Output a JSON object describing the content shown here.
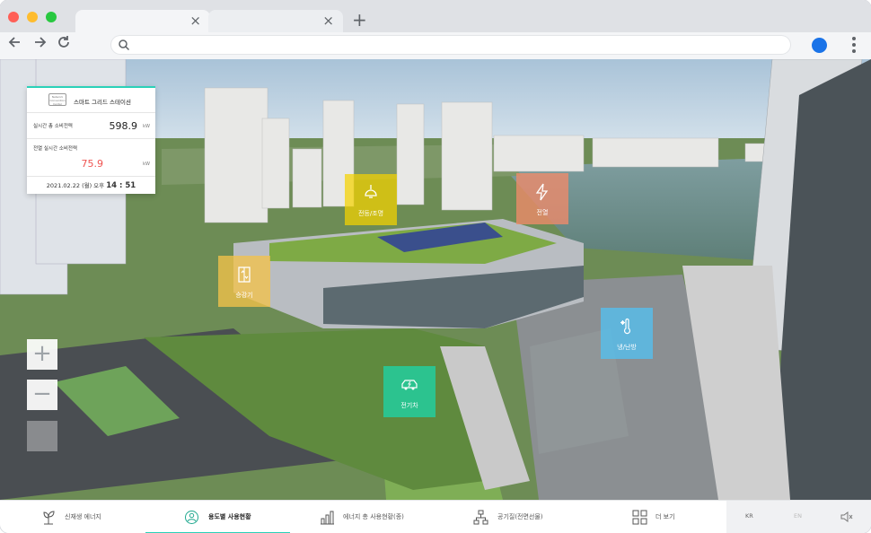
{
  "browser": {
    "tabs": [
      {
        "title": "",
        "close": "×"
      },
      {
        "title": "",
        "close": "×"
      }
    ],
    "new_tab": "+",
    "address": "",
    "address_placeholder": ""
  },
  "info_card": {
    "brand_lines": [
      "Network",
      "Convention",
      "Center"
    ],
    "station_name": "스마트 그리드 스테이션",
    "realtime_total_label": "실시간 총 소비전력",
    "realtime_total_value": "598.9",
    "realtime_total_unit": "kW",
    "lighting_label": "전열 실시간 소비전력",
    "lighting_value": "75.9",
    "lighting_unit": "kW",
    "timestamp_prefix": "2021.02.22 (월) 오후",
    "timestamp_time": "14 : 51"
  },
  "hotspots": [
    {
      "label": "전등/조명",
      "icon": "ceiling-lamp-icon",
      "color": "#f5d300"
    },
    {
      "label": "전열",
      "icon": "lightning-icon",
      "color": "#f08a6a"
    },
    {
      "label": "승강기",
      "icon": "elevator-icon",
      "color": "#f2c14a"
    },
    {
      "label": "냉/난방",
      "icon": "thermometer-snow-icon",
      "color": "#4fc3f7"
    },
    {
      "label": "전기차",
      "icon": "electric-car-icon",
      "color": "#1ed3a6"
    }
  ],
  "zoom": {
    "in": "+",
    "out": "−"
  },
  "bottom_nav": [
    {
      "label": "신재생 에너지",
      "icon": "plant-icon",
      "active": false
    },
    {
      "label": "용도별 사용현황",
      "icon": "chart-circle-icon",
      "active": true
    },
    {
      "label": "에너지 총 사용현황(종)",
      "icon": "bar-chart-icon",
      "active": false
    },
    {
      "label": "공기질(전면선물)",
      "icon": "network-icon",
      "active": false
    },
    {
      "label": "더 보기",
      "icon": "grid-icon",
      "active": false
    }
  ],
  "languages": [
    "KR",
    "EN"
  ],
  "sound_icon": "speaker-icon",
  "colors": {
    "accent": "#2bd1b8",
    "alert_value": "#ef5350"
  }
}
